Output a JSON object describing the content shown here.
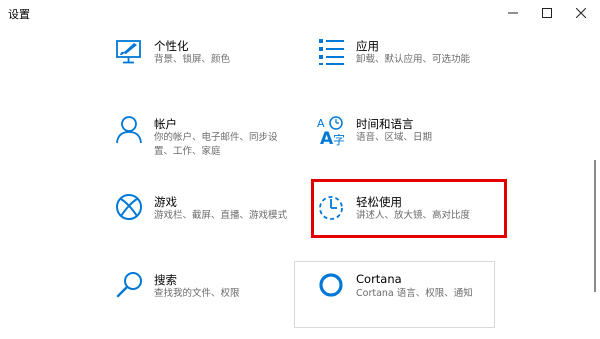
{
  "window": {
    "title": "设置"
  },
  "tiles": [
    {
      "name": "个性化",
      "desc": [
        "背景、锁屏、颜色"
      ],
      "icon": "personalization-icon"
    },
    {
      "name": "应用",
      "desc": [
        "卸载、默认应用、可选功能"
      ],
      "icon": "apps-icon"
    },
    {
      "name": "帐户",
      "desc": [
        "你的帐户、电子邮件、同步设",
        "置、工作、家庭"
      ],
      "icon": "account-icon"
    },
    {
      "name": "时间和语言",
      "desc": [
        "语音、区域、日期"
      ],
      "icon": "time-language-icon"
    },
    {
      "name": "游戏",
      "desc": [
        "游戏栏、截屏、直播、游戏模式"
      ],
      "icon": "xbox-icon"
    },
    {
      "name": "轻松使用",
      "desc": [
        "讲述人、放大镜、高对比度"
      ],
      "icon": "ease-of-access-icon"
    },
    {
      "name": "搜索",
      "desc": [
        "查找我的文件、权限"
      ],
      "icon": "search-icon"
    },
    {
      "name": "Cortana",
      "desc": [
        "Cortana 语言、权限、通知"
      ],
      "icon": "cortana-icon"
    }
  ],
  "colors": {
    "accent": "#0078d7",
    "highlight": "#e30000"
  }
}
